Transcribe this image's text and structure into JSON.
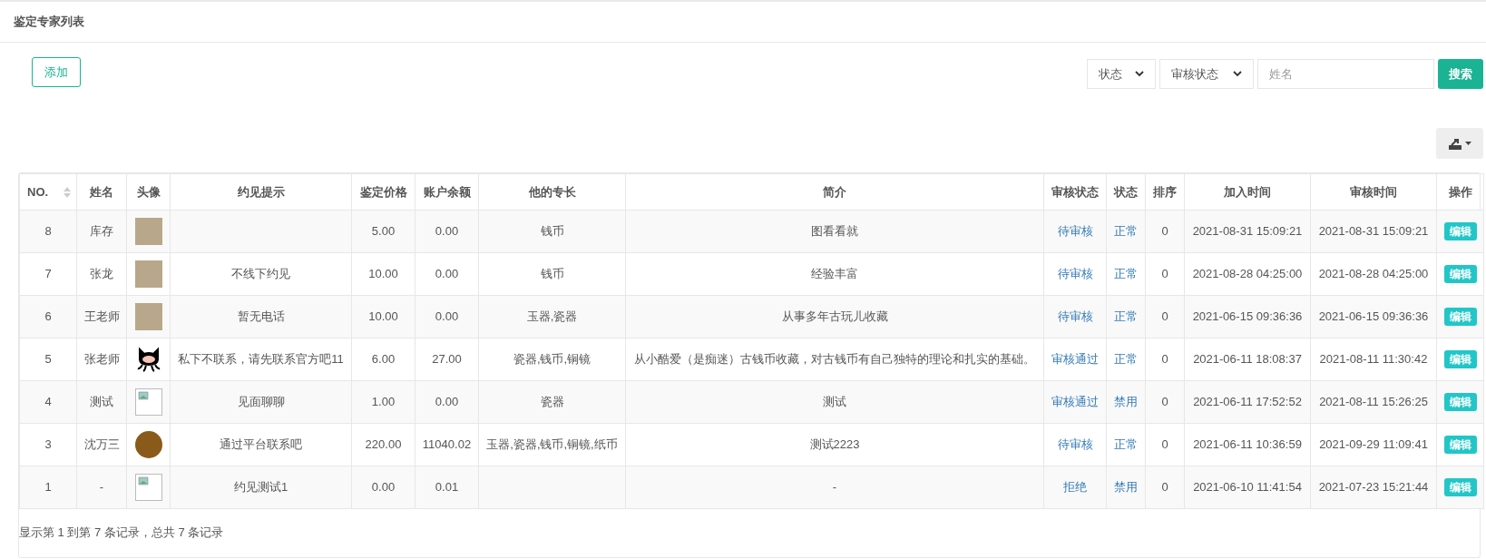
{
  "panel_title": "鉴定专家列表",
  "add_button": "添加",
  "filters": {
    "status_select": "状态",
    "review_select": "审核状态",
    "name_placeholder": "姓名",
    "search_button": "搜索"
  },
  "table": {
    "columns": [
      {
        "label": "NO.",
        "sortable": true
      },
      {
        "label": "姓名",
        "sortable": false
      },
      {
        "label": "头像",
        "sortable": false
      },
      {
        "label": "约见提示",
        "sortable": false
      },
      {
        "label": "鉴定价格",
        "sortable": false
      },
      {
        "label": "账户余额",
        "sortable": false
      },
      {
        "label": "他的专长",
        "sortable": false
      },
      {
        "label": "简介",
        "sortable": false
      },
      {
        "label": "审核状态",
        "sortable": false
      },
      {
        "label": "状态",
        "sortable": false
      },
      {
        "label": "排序",
        "sortable": false
      },
      {
        "label": "加入时间",
        "sortable": false
      },
      {
        "label": "审核时间",
        "sortable": false
      },
      {
        "label": "操作",
        "sortable": false
      }
    ],
    "rows": [
      {
        "no": "8",
        "name": "库存",
        "avatar": {
          "kind": "photo"
        },
        "tip": "",
        "price": "5.00",
        "balance": "0.00",
        "specialty": "钱币",
        "intro": "图看看就",
        "review": "待审核",
        "status": "正常",
        "order": "0",
        "joined": "2021-08-31 15:09:21",
        "reviewed": "2021-08-31 15:09:21",
        "action": "编辑"
      },
      {
        "no": "7",
        "name": "张龙",
        "avatar": {
          "kind": "photo"
        },
        "tip": "不线下约见",
        "price": "10.00",
        "balance": "0.00",
        "specialty": "钱币",
        "intro": "经验丰富",
        "review": "待审核",
        "status": "正常",
        "order": "0",
        "joined": "2021-08-28 04:25:00",
        "reviewed": "2021-08-28 04:25:00",
        "action": "编辑"
      },
      {
        "no": "6",
        "name": "王老师",
        "avatar": {
          "kind": "photo"
        },
        "tip": "暂无电话",
        "price": "10.00",
        "balance": "0.00",
        "specialty": "玉器,瓷器",
        "intro": "从事多年古玩儿收藏",
        "review": "待审核",
        "status": "正常",
        "order": "0",
        "joined": "2021-06-15 09:36:36",
        "reviewed": "2021-06-15 09:36:36",
        "action": "编辑"
      },
      {
        "no": "5",
        "name": "张老师",
        "avatar": {
          "kind": "octocat"
        },
        "tip": "私下不联系，请先联系官方吧11",
        "price": "6.00",
        "balance": "27.00",
        "specialty": "瓷器,钱币,铜镜",
        "intro": "从小酷爱（是痴迷）古钱币收藏，对古钱币有自己独特的理论和扎实的基础。",
        "review": "审核通过",
        "status": "正常",
        "order": "0",
        "joined": "2021-06-11 18:08:37",
        "reviewed": "2021-08-11 11:30:42",
        "action": "编辑"
      },
      {
        "no": "4",
        "name": "测试",
        "avatar": {
          "kind": "broken"
        },
        "tip": "见面聊聊",
        "price": "1.00",
        "balance": "0.00",
        "specialty": "瓷器",
        "intro": "测试",
        "review": "审核通过",
        "status": "禁用",
        "order": "0",
        "joined": "2021-06-11 17:52:52",
        "reviewed": "2021-08-11 15:26:25",
        "action": "编辑"
      },
      {
        "no": "3",
        "name": "沈万三",
        "avatar": {
          "kind": "round_photo"
        },
        "tip": "通过平台联系吧",
        "price": "220.00",
        "balance": "11040.02",
        "specialty": "玉器,瓷器,钱币,铜镜,纸币",
        "intro": "测试2223",
        "review": "待审核",
        "status": "正常",
        "order": "0",
        "joined": "2021-06-11 10:36:59",
        "reviewed": "2021-09-29 11:09:41",
        "action": "编辑"
      },
      {
        "no": "1",
        "name": "-",
        "avatar": {
          "kind": "broken"
        },
        "tip": "约见测试1",
        "price": "0.00",
        "balance": "0.01",
        "specialty": "",
        "intro": "-",
        "review": "拒绝",
        "status": "禁用",
        "order": "0",
        "joined": "2021-06-10 11:41:54",
        "reviewed": "2021-07-23 15:21:44",
        "action": "编辑"
      }
    ]
  },
  "footer": "显示第 1 到第 7 条记录，总共 7 条记录"
}
